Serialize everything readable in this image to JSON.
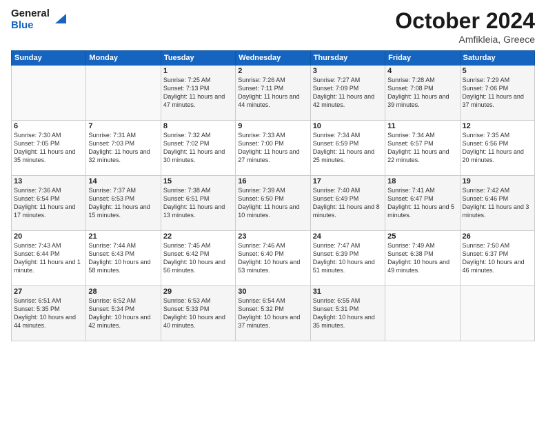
{
  "logo": {
    "line1": "General",
    "line2": "Blue"
  },
  "title": "October 2024",
  "subtitle": "Amfikleia, Greece",
  "days_of_week": [
    "Sunday",
    "Monday",
    "Tuesday",
    "Wednesday",
    "Thursday",
    "Friday",
    "Saturday"
  ],
  "weeks": [
    [
      {
        "num": "",
        "info": ""
      },
      {
        "num": "",
        "info": ""
      },
      {
        "num": "1",
        "info": "Sunrise: 7:25 AM\nSunset: 7:13 PM\nDaylight: 11 hours and 47 minutes."
      },
      {
        "num": "2",
        "info": "Sunrise: 7:26 AM\nSunset: 7:11 PM\nDaylight: 11 hours and 44 minutes."
      },
      {
        "num": "3",
        "info": "Sunrise: 7:27 AM\nSunset: 7:09 PM\nDaylight: 11 hours and 42 minutes."
      },
      {
        "num": "4",
        "info": "Sunrise: 7:28 AM\nSunset: 7:08 PM\nDaylight: 11 hours and 39 minutes."
      },
      {
        "num": "5",
        "info": "Sunrise: 7:29 AM\nSunset: 7:06 PM\nDaylight: 11 hours and 37 minutes."
      }
    ],
    [
      {
        "num": "6",
        "info": "Sunrise: 7:30 AM\nSunset: 7:05 PM\nDaylight: 11 hours and 35 minutes."
      },
      {
        "num": "7",
        "info": "Sunrise: 7:31 AM\nSunset: 7:03 PM\nDaylight: 11 hours and 32 minutes."
      },
      {
        "num": "8",
        "info": "Sunrise: 7:32 AM\nSunset: 7:02 PM\nDaylight: 11 hours and 30 minutes."
      },
      {
        "num": "9",
        "info": "Sunrise: 7:33 AM\nSunset: 7:00 PM\nDaylight: 11 hours and 27 minutes."
      },
      {
        "num": "10",
        "info": "Sunrise: 7:34 AM\nSunset: 6:59 PM\nDaylight: 11 hours and 25 minutes."
      },
      {
        "num": "11",
        "info": "Sunrise: 7:34 AM\nSunset: 6:57 PM\nDaylight: 11 hours and 22 minutes."
      },
      {
        "num": "12",
        "info": "Sunrise: 7:35 AM\nSunset: 6:56 PM\nDaylight: 11 hours and 20 minutes."
      }
    ],
    [
      {
        "num": "13",
        "info": "Sunrise: 7:36 AM\nSunset: 6:54 PM\nDaylight: 11 hours and 17 minutes."
      },
      {
        "num": "14",
        "info": "Sunrise: 7:37 AM\nSunset: 6:53 PM\nDaylight: 11 hours and 15 minutes."
      },
      {
        "num": "15",
        "info": "Sunrise: 7:38 AM\nSunset: 6:51 PM\nDaylight: 11 hours and 13 minutes."
      },
      {
        "num": "16",
        "info": "Sunrise: 7:39 AM\nSunset: 6:50 PM\nDaylight: 11 hours and 10 minutes."
      },
      {
        "num": "17",
        "info": "Sunrise: 7:40 AM\nSunset: 6:49 PM\nDaylight: 11 hours and 8 minutes."
      },
      {
        "num": "18",
        "info": "Sunrise: 7:41 AM\nSunset: 6:47 PM\nDaylight: 11 hours and 5 minutes."
      },
      {
        "num": "19",
        "info": "Sunrise: 7:42 AM\nSunset: 6:46 PM\nDaylight: 11 hours and 3 minutes."
      }
    ],
    [
      {
        "num": "20",
        "info": "Sunrise: 7:43 AM\nSunset: 6:44 PM\nDaylight: 11 hours and 1 minute."
      },
      {
        "num": "21",
        "info": "Sunrise: 7:44 AM\nSunset: 6:43 PM\nDaylight: 10 hours and 58 minutes."
      },
      {
        "num": "22",
        "info": "Sunrise: 7:45 AM\nSunset: 6:42 PM\nDaylight: 10 hours and 56 minutes."
      },
      {
        "num": "23",
        "info": "Sunrise: 7:46 AM\nSunset: 6:40 PM\nDaylight: 10 hours and 53 minutes."
      },
      {
        "num": "24",
        "info": "Sunrise: 7:47 AM\nSunset: 6:39 PM\nDaylight: 10 hours and 51 minutes."
      },
      {
        "num": "25",
        "info": "Sunrise: 7:49 AM\nSunset: 6:38 PM\nDaylight: 10 hours and 49 minutes."
      },
      {
        "num": "26",
        "info": "Sunrise: 7:50 AM\nSunset: 6:37 PM\nDaylight: 10 hours and 46 minutes."
      }
    ],
    [
      {
        "num": "27",
        "info": "Sunrise: 6:51 AM\nSunset: 5:35 PM\nDaylight: 10 hours and 44 minutes."
      },
      {
        "num": "28",
        "info": "Sunrise: 6:52 AM\nSunset: 5:34 PM\nDaylight: 10 hours and 42 minutes."
      },
      {
        "num": "29",
        "info": "Sunrise: 6:53 AM\nSunset: 5:33 PM\nDaylight: 10 hours and 40 minutes."
      },
      {
        "num": "30",
        "info": "Sunrise: 6:54 AM\nSunset: 5:32 PM\nDaylight: 10 hours and 37 minutes."
      },
      {
        "num": "31",
        "info": "Sunrise: 6:55 AM\nSunset: 5:31 PM\nDaylight: 10 hours and 35 minutes."
      },
      {
        "num": "",
        "info": ""
      },
      {
        "num": "",
        "info": ""
      }
    ]
  ]
}
